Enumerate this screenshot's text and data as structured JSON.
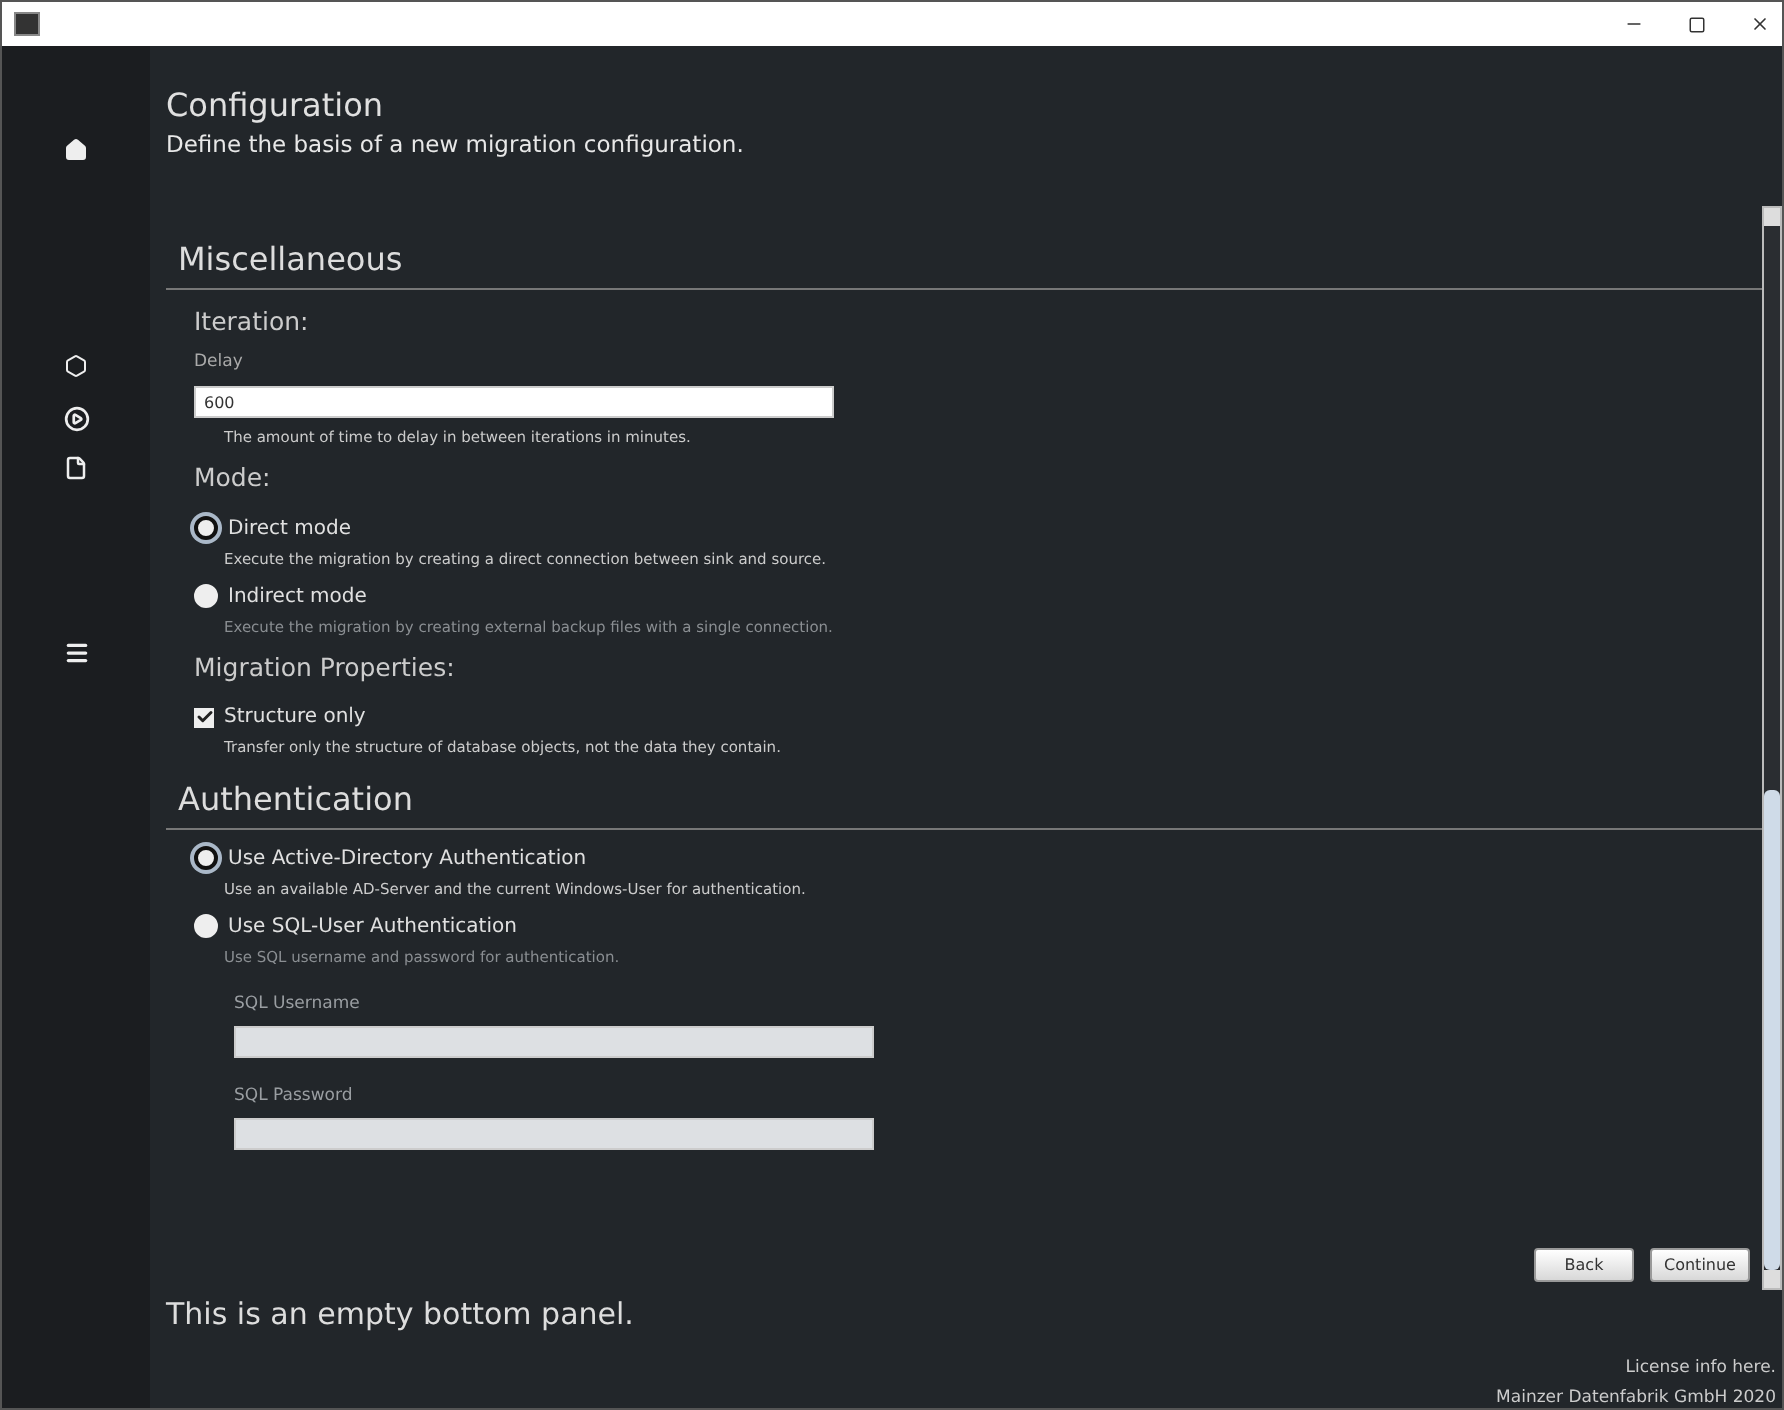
{
  "header": {
    "title": "Configuration",
    "subtitle": "Define the basis of a new migration configuration."
  },
  "sections": [
    {
      "title": "Miscellaneous",
      "groups": [
        {
          "title": "Iteration:",
          "items": [
            {
              "kind": "field",
              "label": "Delay",
              "value": "600",
              "help": "The amount of time to delay in between iterations in minutes.",
              "disabled": false
            }
          ]
        },
        {
          "title": "Mode:",
          "items": [
            {
              "kind": "radio",
              "label": "Direct mode",
              "help": "Execute the migration by creating a direct connection between sink and source.",
              "selected": true,
              "disabled": false
            },
            {
              "kind": "radio",
              "label": "Indirect mode",
              "help": "Execute the migration by creating external backup files with a single connection.",
              "selected": false,
              "disabled": false
            }
          ]
        },
        {
          "title": "Migration Properties:",
          "items": [
            {
              "kind": "checkbox",
              "label": "Structure only",
              "help": "Transfer only the structure of database objects, not the data they contain.",
              "checked": true
            }
          ]
        }
      ]
    },
    {
      "title": "Authentication",
      "groups": [
        {
          "items": [
            {
              "kind": "radio",
              "label": "Use Active-Directory Authentication",
              "help": "Use an available AD-Server and the current Windows-User for authentication.",
              "selected": true,
              "disabled": false
            },
            {
              "kind": "radio",
              "label": "Use SQL-User Authentication",
              "help": "Use SQL username and password for authentication.",
              "selected": false,
              "disabled": false
            },
            {
              "kind": "field",
              "label": "SQL Username",
              "disabled": true
            },
            {
              "kind": "field",
              "label": "SQL Password",
              "disabled": true
            }
          ]
        }
      ]
    }
  ],
  "buttons": [
    "Back",
    "Continue"
  ],
  "bottom_panel": {
    "text": "This is an empty bottom panel.",
    "license": "License info here.",
    "company": "Mainzer Datenfabrik GmbH 2020"
  }
}
